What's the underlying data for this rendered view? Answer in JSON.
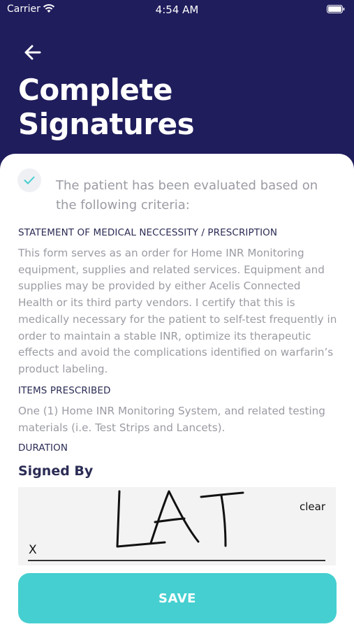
{
  "status_bar": {
    "carrier": "Carrier",
    "time": "4:54 AM"
  },
  "header": {
    "title": "Complete Signatures"
  },
  "criteria": {
    "checked": true,
    "text": "The patient has been evaluated based on the following criteria:"
  },
  "sections": [
    {
      "label": "STATEMENT OF MEDICAL NECCESSITY / PRESCRIPTION",
      "body": "This form serves as an order for Home INR Monitoring equipment, supplies and related services. Equipment and supplies may be provided by either Acelis Connected Health or its third party vendors. I certify that this is medically necessary for the patient to self-test frequently in order to maintain a stable INR, optimize its therapeutic effects and avoid the complications identified on warfarin’s product labeling."
    },
    {
      "label": "ITEMS PRESCRIBED",
      "body": "One (1) Home INR Monitoring System, and related testing materials (i.e. Test Strips and Lancets)."
    },
    {
      "label": "DURATION",
      "body": ""
    }
  ],
  "signature": {
    "heading": "Signed By",
    "x_mark": "X",
    "clear_label": "clear",
    "handwritten": "LAT"
  },
  "save_label": "SAVE",
  "colors": {
    "header_bg": "#1f1d5c",
    "accent": "#45cfd0",
    "section_text": "#2b2c55",
    "body_text": "#9a9ca3"
  }
}
